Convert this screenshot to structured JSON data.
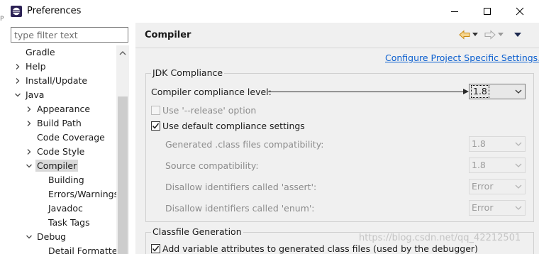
{
  "window": {
    "title": "Preferences",
    "edge_text": "Pr"
  },
  "filter": {
    "placeholder": "type filter text"
  },
  "tree": {
    "items": [
      {
        "label": "Gradle",
        "level": 0,
        "expander": "none"
      },
      {
        "label": "Help",
        "level": 0,
        "expander": "collapsed"
      },
      {
        "label": "Install/Update",
        "level": 0,
        "expander": "collapsed"
      },
      {
        "label": "Java",
        "level": 0,
        "expander": "expanded"
      },
      {
        "label": "Appearance",
        "level": 1,
        "expander": "collapsed"
      },
      {
        "label": "Build Path",
        "level": 1,
        "expander": "collapsed"
      },
      {
        "label": "Code Coverage",
        "level": 1,
        "expander": "none"
      },
      {
        "label": "Code Style",
        "level": 1,
        "expander": "collapsed"
      },
      {
        "label": "Compiler",
        "level": 1,
        "expander": "expanded",
        "selected": true
      },
      {
        "label": "Building",
        "level": 2,
        "expander": "none"
      },
      {
        "label": "Errors/Warnings",
        "level": 2,
        "expander": "none"
      },
      {
        "label": "Javadoc",
        "level": 2,
        "expander": "none"
      },
      {
        "label": "Task Tags",
        "level": 2,
        "expander": "none"
      },
      {
        "label": "Debug",
        "level": 1,
        "expander": "expanded"
      },
      {
        "label": "Detail Formatters",
        "level": 2,
        "expander": "none"
      }
    ]
  },
  "page": {
    "title": "Compiler",
    "config_link": "Configure Project Specific Settings...",
    "jdk_group": {
      "title": "JDK Compliance",
      "compliance_label": "Compiler compliance level:",
      "compliance_value": "1.8",
      "release_option": {
        "label": "Use '--release' option",
        "checked": false,
        "enabled": false
      },
      "default_settings": {
        "label": "Use default compliance settings",
        "checked": true,
        "enabled": true
      },
      "rows": [
        {
          "label": "Generated .class files compatibility:",
          "value": "1.8"
        },
        {
          "label": "Source compatibility:",
          "value": "1.8"
        },
        {
          "label": "Disallow identifiers called 'assert':",
          "value": "Error"
        },
        {
          "label": "Disallow identifiers called 'enum':",
          "value": "Error"
        }
      ]
    },
    "classfile_group": {
      "title": "Classfile Generation",
      "add_variable": {
        "label": "Add variable attributes to generated class files (used by the debugger)",
        "checked": true
      }
    }
  },
  "watermark": "https://blog.csdn.net/qq_42212501",
  "colors": {
    "link": "#0b5fcf",
    "pane_bg": "#f0f0f0",
    "selection": "#d9d9d9",
    "nav_back_arrow": "#e8a33a"
  }
}
